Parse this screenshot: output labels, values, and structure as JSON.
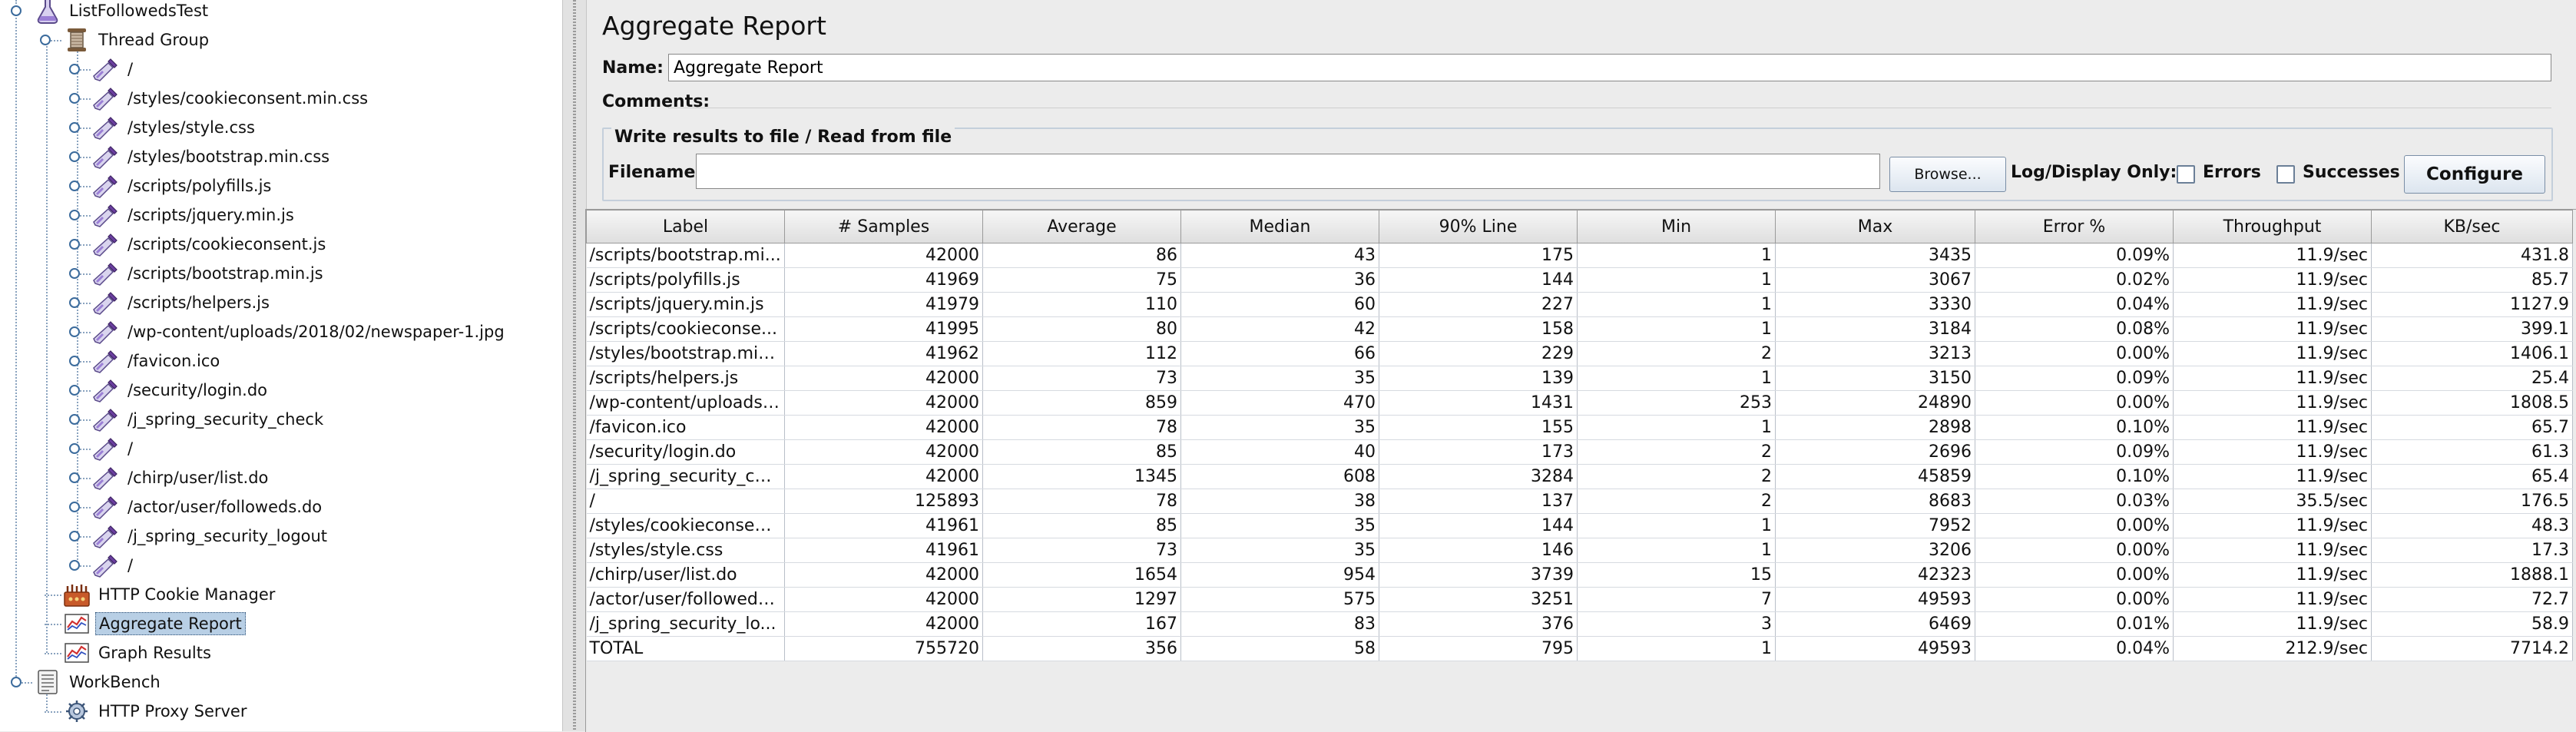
{
  "tree": {
    "items": [
      {
        "label": "ListFollowedsTest",
        "icon": "flask-icon"
      },
      {
        "label": "Thread Group",
        "icon": "spool-icon"
      },
      {
        "label": "/",
        "icon": "pipette-icon"
      },
      {
        "label": "/styles/cookieconsent.min.css",
        "icon": "pipette-icon"
      },
      {
        "label": "/styles/style.css",
        "icon": "pipette-icon"
      },
      {
        "label": "/styles/bootstrap.min.css",
        "icon": "pipette-icon"
      },
      {
        "label": "/scripts/polyfills.js",
        "icon": "pipette-icon"
      },
      {
        "label": "/scripts/jquery.min.js",
        "icon": "pipette-icon"
      },
      {
        "label": "/scripts/cookieconsent.js",
        "icon": "pipette-icon"
      },
      {
        "label": "/scripts/bootstrap.min.js",
        "icon": "pipette-icon"
      },
      {
        "label": "/scripts/helpers.js",
        "icon": "pipette-icon"
      },
      {
        "label": "/wp-content/uploads/2018/02/newspaper-1.jpg",
        "icon": "pipette-icon"
      },
      {
        "label": "/favicon.ico",
        "icon": "pipette-icon"
      },
      {
        "label": "/security/login.do",
        "icon": "pipette-icon"
      },
      {
        "label": "/j_spring_security_check",
        "icon": "pipette-icon"
      },
      {
        "label": "/",
        "icon": "pipette-icon"
      },
      {
        "label": "/chirp/user/list.do",
        "icon": "pipette-icon"
      },
      {
        "label": "/actor/user/followeds.do",
        "icon": "pipette-icon"
      },
      {
        "label": "/j_spring_security_logout",
        "icon": "pipette-icon"
      },
      {
        "label": "/",
        "icon": "pipette-icon"
      },
      {
        "label": "HTTP Cookie Manager",
        "icon": "cookie-manager-icon"
      },
      {
        "label": "Aggregate Report",
        "icon": "chart-report-icon",
        "selected": true
      },
      {
        "label": "Graph Results",
        "icon": "chart-report-icon"
      },
      {
        "label": "WorkBench",
        "icon": "workbench-icon"
      },
      {
        "label": "HTTP Proxy Server",
        "icon": "proxy-gear-icon"
      }
    ]
  },
  "panel": {
    "title": "Aggregate Report",
    "name_label": "Name:",
    "name_value": "Aggregate Report",
    "comments_label": "Comments:",
    "file_section_title": "Write results to file / Read from file",
    "filename_label": "Filename",
    "filename_value": "",
    "browse_label": "Browse...",
    "log_display_label": "Log/Display Only:",
    "errors_label": "Errors",
    "successes_label": "Successes",
    "configure_label": "Configure"
  },
  "table": {
    "columns": [
      "Label",
      "# Samples",
      "Average",
      "Median",
      "90% Line",
      "Min",
      "Max",
      "Error %",
      "Throughput",
      "KB/sec"
    ],
    "rows": [
      [
        "/scripts/bootstrap.mi...",
        "42000",
        "86",
        "43",
        "175",
        "1",
        "3435",
        "0.09%",
        "11.9/sec",
        "431.8"
      ],
      [
        "/scripts/polyfills.js",
        "41969",
        "75",
        "36",
        "144",
        "1",
        "3067",
        "0.02%",
        "11.9/sec",
        "85.7"
      ],
      [
        "/scripts/jquery.min.js",
        "41979",
        "110",
        "60",
        "227",
        "1",
        "3330",
        "0.04%",
        "11.9/sec",
        "1127.9"
      ],
      [
        "/scripts/cookieconse...",
        "41995",
        "80",
        "42",
        "158",
        "1",
        "3184",
        "0.08%",
        "11.9/sec",
        "399.1"
      ],
      [
        "/styles/bootstrap.min....",
        "41962",
        "112",
        "66",
        "229",
        "2",
        "3213",
        "0.00%",
        "11.9/sec",
        "1406.1"
      ],
      [
        "/scripts/helpers.js",
        "42000",
        "73",
        "35",
        "139",
        "1",
        "3150",
        "0.09%",
        "11.9/sec",
        "25.4"
      ],
      [
        "/wp-content/uploads/...",
        "42000",
        "859",
        "470",
        "1431",
        "253",
        "24890",
        "0.00%",
        "11.9/sec",
        "1808.5"
      ],
      [
        "/favicon.ico",
        "42000",
        "78",
        "35",
        "155",
        "1",
        "2898",
        "0.10%",
        "11.9/sec",
        "65.7"
      ],
      [
        "/security/login.do",
        "42000",
        "85",
        "40",
        "173",
        "2",
        "2696",
        "0.09%",
        "11.9/sec",
        "61.3"
      ],
      [
        "/j_spring_security_ch...",
        "42000",
        "1345",
        "608",
        "3284",
        "2",
        "45859",
        "0.10%",
        "11.9/sec",
        "65.4"
      ],
      [
        "/",
        "125893",
        "78",
        "38",
        "137",
        "2",
        "8683",
        "0.03%",
        "35.5/sec",
        "176.5"
      ],
      [
        "/styles/cookieconsen...",
        "41961",
        "85",
        "35",
        "144",
        "1",
        "7952",
        "0.00%",
        "11.9/sec",
        "48.3"
      ],
      [
        "/styles/style.css",
        "41961",
        "73",
        "35",
        "146",
        "1",
        "3206",
        "0.00%",
        "11.9/sec",
        "17.3"
      ],
      [
        "/chirp/user/list.do",
        "42000",
        "1654",
        "954",
        "3739",
        "15",
        "42323",
        "0.00%",
        "11.9/sec",
        "1888.1"
      ],
      [
        "/actor/user/followeds....",
        "42000",
        "1297",
        "575",
        "3251",
        "7",
        "49593",
        "0.00%",
        "11.9/sec",
        "72.7"
      ],
      [
        "/j_spring_security_lo...",
        "42000",
        "167",
        "83",
        "376",
        "3",
        "6469",
        "0.01%",
        "11.9/sec",
        "58.9"
      ],
      [
        "TOTAL",
        "755720",
        "356",
        "58",
        "795",
        "1",
        "49593",
        "0.04%",
        "212.9/sec",
        "7714.2"
      ]
    ]
  }
}
